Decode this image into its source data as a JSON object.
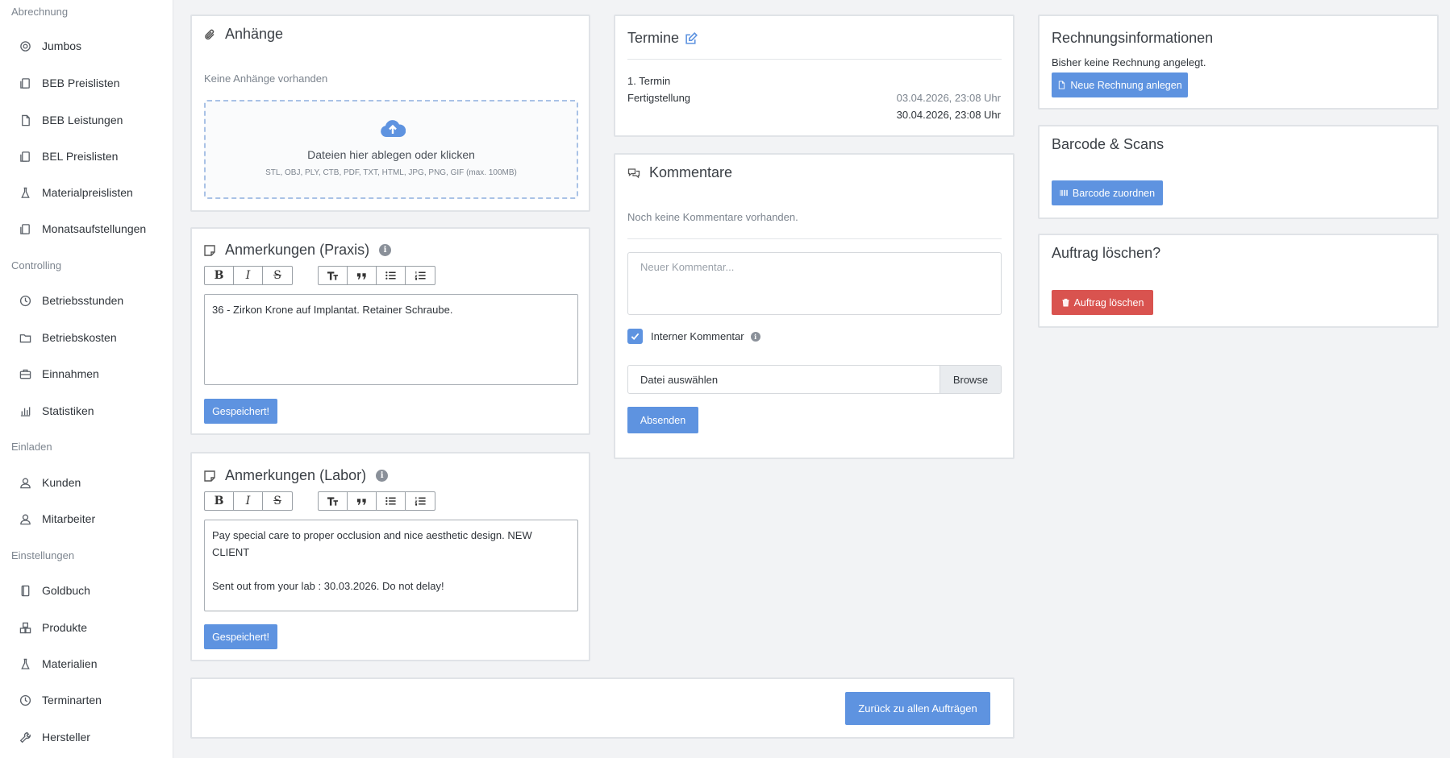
{
  "sidebar": {
    "sections": [
      {
        "title": "Abrechnung",
        "items": [
          "Jumbos",
          "BEB Preislisten",
          "BEB Leistungen",
          "BEL Preislisten",
          "Materialpreislisten",
          "Monatsaufstellungen"
        ]
      },
      {
        "title": "Controlling",
        "items": [
          "Betriebsstunden",
          "Betriebskosten",
          "Einnahmen",
          "Statistiken"
        ]
      },
      {
        "title": "Einladen",
        "items": [
          "Kunden",
          "Mitarbeiter"
        ]
      },
      {
        "title": "Einstellungen",
        "items": [
          "Goldbuch",
          "Produkte",
          "Materialien",
          "Terminarten",
          "Hersteller"
        ]
      }
    ]
  },
  "attachments": {
    "title": "Anhänge",
    "empty": "Keine Anhänge vorhanden",
    "drop_main": "Dateien hier ablegen oder klicken",
    "drop_sub": "STL, OBJ, PLY, CTB, PDF, TXT, HTML, JPG, PNG, GIF (max. 100MB)"
  },
  "notes_praxis": {
    "title": "Anmerkungen (Praxis)",
    "text_line1": "36 - Zirkon Krone auf Implantat. Retainer Schraube.",
    "saved_label": "Gespeichert!"
  },
  "notes_labor": {
    "title": "Anmerkungen (Labor)",
    "text_line1": "Pay special care to proper occlusion and nice aesthetic design. NEW CLIENT",
    "text_line2": "Sent out from your lab : 30.03.2026. Do not delay!",
    "saved_label": "Gespeichert!"
  },
  "termine": {
    "title": "Termine",
    "row1_label": "1. Termin",
    "row2_label": "Fertigstellung",
    "row2_date1": "03.04.2026, 23:08 Uhr",
    "row2_date2": "30.04.2026, 23:08 Uhr"
  },
  "comments": {
    "title": "Kommentare",
    "empty": "Noch keine Kommentare vorhanden.",
    "placeholder": "Neuer Kommentar...",
    "internal_label": "Interner Kommentar",
    "file_text": "Datei auswählen",
    "browse": "Browse",
    "send": "Absenden"
  },
  "invoice": {
    "title": "Rechnungsinformationen",
    "text": "Bisher keine Rechnung angelegt.",
    "button": "Neue Rechnung anlegen"
  },
  "barcode": {
    "title": "Barcode & Scans",
    "button": "Barcode zuordnen"
  },
  "delete": {
    "title": "Auftrag löschen?",
    "button": "Auftrag löschen"
  },
  "footer": {
    "back_button": "Zurück zu allen Aufträgen"
  },
  "colors": {
    "primary": "#5e93e0",
    "danger": "#d9534f"
  }
}
